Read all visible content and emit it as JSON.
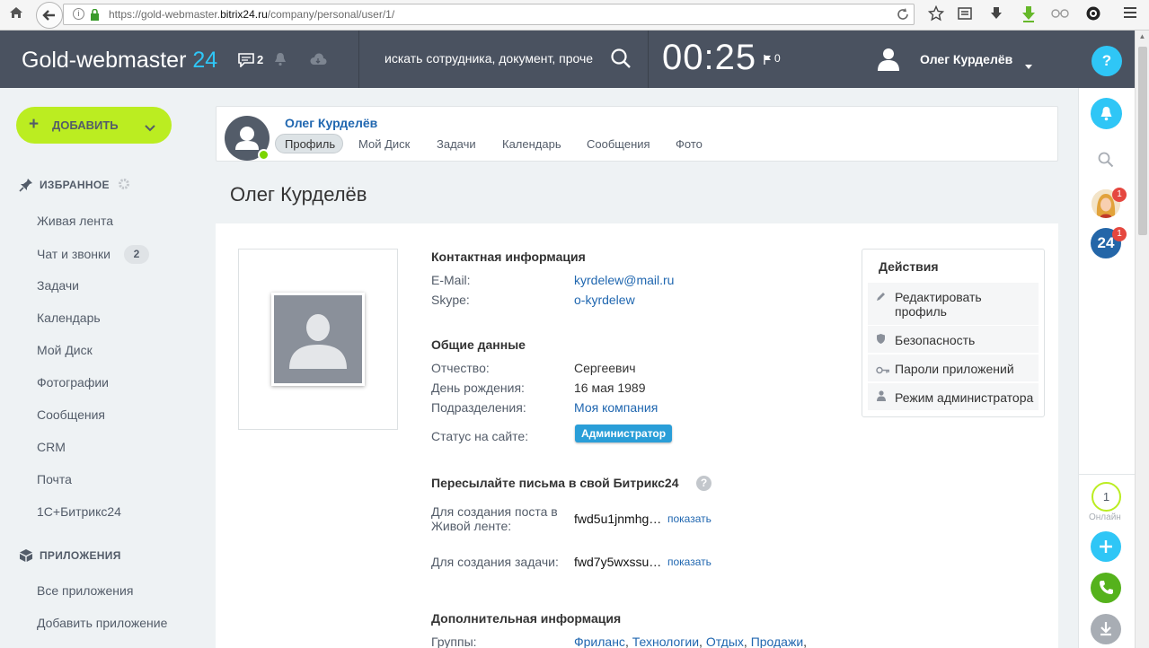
{
  "browser": {
    "url_prefix": "https://gold-webmaster.",
    "url_domain": "bitrix24.ru",
    "url_path": "/company/personal/user/1/"
  },
  "header": {
    "logo_main": "Gold-webmaster",
    "logo_suffix": "24",
    "chat_count": "2",
    "search_placeholder": "искать сотрудника, документ, проче",
    "clock": "00:25",
    "flag_count": "0",
    "user_name": "Олег Курделёв",
    "help": "?"
  },
  "sidebar": {
    "add_label": "ДОБАВИТЬ",
    "favorites_title": "ИЗБРАННОЕ",
    "favorites": [
      {
        "label": "Живая лента"
      },
      {
        "label": "Чат и звонки",
        "badge": "2"
      },
      {
        "label": "Задачи"
      },
      {
        "label": "Календарь"
      },
      {
        "label": "Мой Диск"
      },
      {
        "label": "Фотографии"
      },
      {
        "label": "Сообщения"
      },
      {
        "label": "CRM"
      },
      {
        "label": "Почта"
      },
      {
        "label": "1С+Битрикс24"
      }
    ],
    "apps_title": "ПРИЛОЖЕНИЯ",
    "apps": [
      {
        "label": "Все приложения"
      },
      {
        "label": "Добавить приложение"
      }
    ]
  },
  "profile_bar": {
    "name": "Олег Курделёв",
    "tabs": [
      "Профиль",
      "Мой Диск",
      "Задачи",
      "Календарь",
      "Сообщения",
      "Фото"
    ]
  },
  "page_title": "Олег Курделёв",
  "contact": {
    "title": "Контактная информация",
    "email_label": "E-Mail:",
    "email": "kyrdelew@mail.ru",
    "skype_label": "Skype:",
    "skype": "o-kyrdelew"
  },
  "general": {
    "title": "Общие данные",
    "patronymic_label": "Отчество:",
    "patronymic": "Сергеевич",
    "birthday_label": "День рождения:",
    "birthday": "16 мая 1989",
    "dept_label": "Подразделения:",
    "dept": "Моя компания",
    "status_label": "Статус на сайте:",
    "status": "Администратор"
  },
  "forward": {
    "title": "Пересылайте письма в свой Битрикс24",
    "post_label_1": "Для создания поста в",
    "post_label_2": "Живой ленте:",
    "post_value": "fwd5u1jnmhg…",
    "task_label": "Для создания задачи:",
    "task_value": "fwd7y5wxssu…",
    "show": "показать"
  },
  "extra": {
    "title": "Дополнительная информация",
    "groups_label": "Группы:",
    "groups": [
      "Фриланс",
      "Технологии",
      "Отдых",
      "Продажи"
    ]
  },
  "actions": {
    "title": "Действия",
    "items": [
      "Редактировать профиль",
      "Безопасность",
      "Пароли приложений",
      "Режим администратора"
    ]
  },
  "right_panel": {
    "badge1": "1",
    "badge2": "1",
    "bitrix_label": "24",
    "online_count": "1",
    "online_label": "Онлайн"
  },
  "colors": {
    "header_bg": "#4a5260",
    "accent": "#2fc6f6",
    "add_button": "#bbed21",
    "link": "#2067b0",
    "status_badge": "#2a9ed8"
  }
}
